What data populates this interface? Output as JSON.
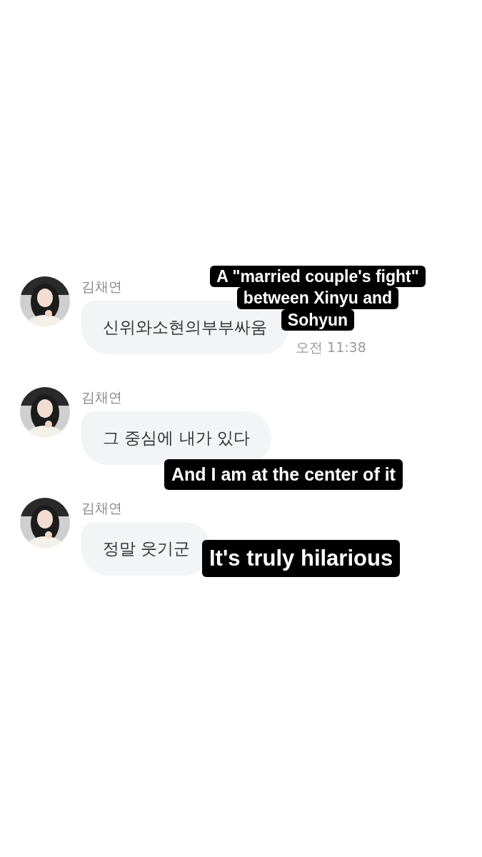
{
  "messages": [
    {
      "sender": "김채연",
      "text": "신위와소현의부부싸움",
      "time": "오전 11:38"
    },
    {
      "sender": "김채연",
      "text": "그 중심에 내가 있다"
    },
    {
      "sender": "김채연",
      "text": "정말 웃기군"
    }
  ],
  "captions": [
    {
      "lines": [
        "A \"married couple's fight\"",
        "between Xinyu and",
        "Sohyun"
      ]
    },
    {
      "lines": [
        "And I am at the center of it"
      ]
    },
    {
      "lines": [
        "It's truly hilarious"
      ]
    }
  ]
}
